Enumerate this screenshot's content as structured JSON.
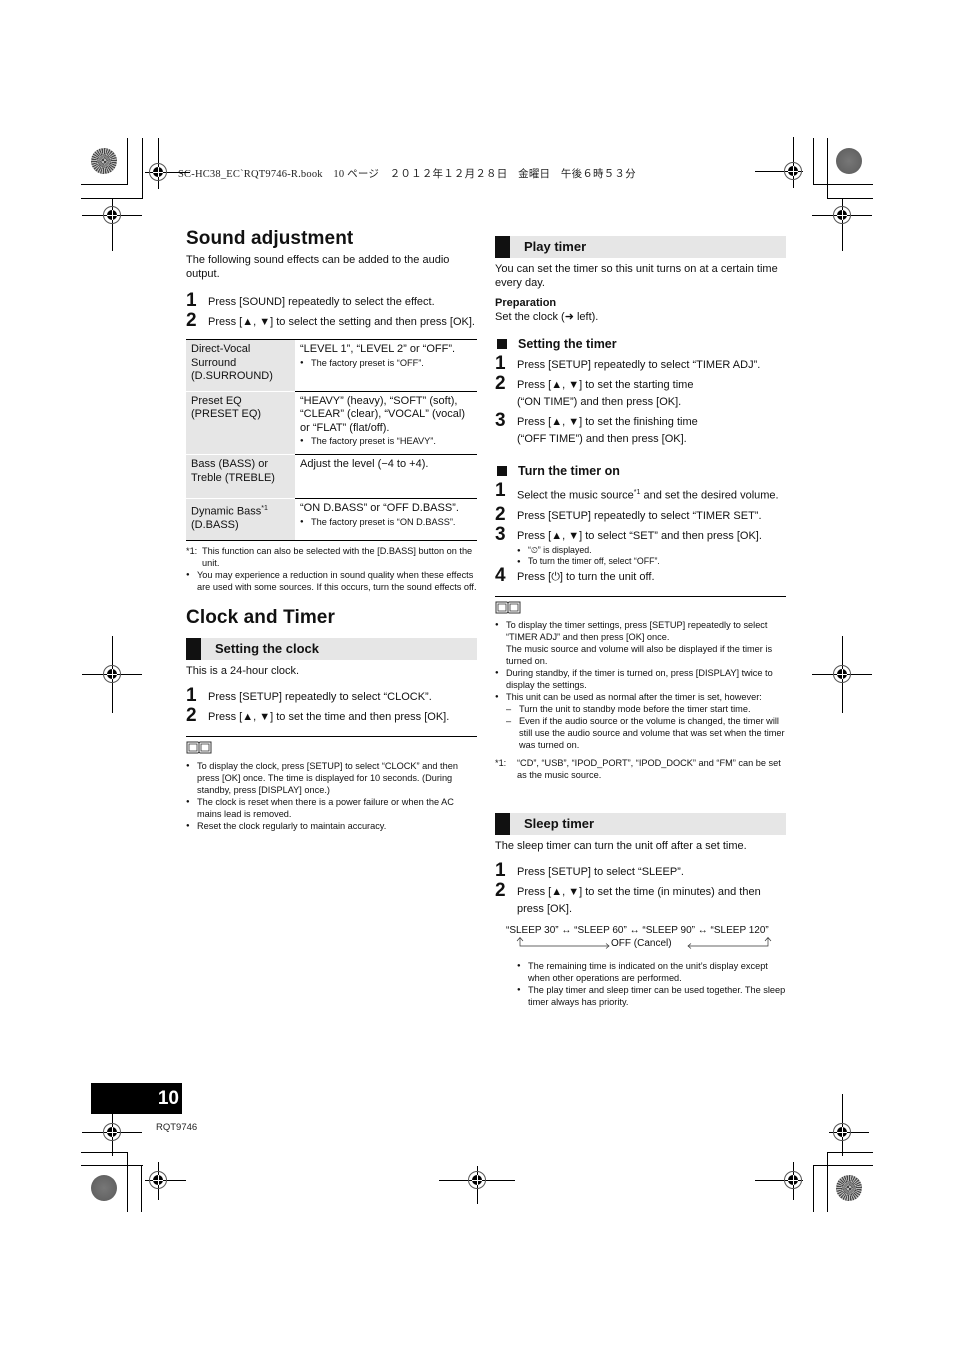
{
  "header": {
    "print_line": "SC-HC38_EC`RQT9746-R.book　10 ページ　２０１２年１２月２８日　金曜日　午後６時５３分"
  },
  "sound_adjustment": {
    "title": "Sound adjustment",
    "intro": "The following sound effects can be added to the audio output.",
    "steps": [
      {
        "num": "1",
        "text": "Press [SOUND] repeatedly to select the effect."
      },
      {
        "num": "2",
        "text": "Press [▲, ▼] to select the setting and then press [OK]."
      }
    ],
    "table": [
      {
        "name": "Direct-Vocal Surround (D.SURROUND)",
        "value": "“LEVEL 1”, “LEVEL 2” or “OFF”.",
        "note": "The factory preset is “OFF”."
      },
      {
        "name": "Preset EQ (PRESET EQ)",
        "value": "“HEAVY” (heavy), “SOFT” (soft), “CLEAR” (clear), “VOCAL” (vocal) or “FLAT” (flat/off).",
        "note": "The factory preset is “HEAVY”."
      },
      {
        "name": "Bass (BASS) or Treble (TREBLE)",
        "value": "Adjust the level (−4 to +4).",
        "note": ""
      },
      {
        "name": "Dynamic Bass",
        "name_sup": "*1",
        "name2": "(D.BASS)",
        "value": "“ON D.BASS” or “OFF D.BASS”.",
        "note": "The factory preset is “ON D.BASS”."
      }
    ],
    "footnote_mark": "*1:",
    "footnote": "This function can also be selected with the [D.BASS] button on the unit.",
    "bullet": "You may experience a reduction in sound quality when these effects are used with some sources. If this occurs, turn the sound effects off."
  },
  "clock_timer": {
    "title": "Clock and Timer",
    "setting_clock": {
      "heading": "Setting the clock",
      "intro": "This is a 24-hour clock.",
      "steps": [
        {
          "num": "1",
          "text": "Press [SETUP] repeatedly to select “CLOCK”."
        },
        {
          "num": "2",
          "text": "Press [▲, ▼] to set the time and then press [OK]."
        }
      ],
      "notes": [
        "To display the clock, press [SETUP] to select “CLOCK” and then press [OK] once. The time is displayed for 10 seconds. (During standby, press [DISPLAY] once.)",
        "The clock is reset when there is a power failure or when the AC mains lead is removed.",
        "Reset the clock regularly to maintain accuracy."
      ]
    }
  },
  "play_timer": {
    "heading": "Play timer",
    "intro": "You can set the timer so this unit turns on at a certain time every day.",
    "prep_label": "Preparation",
    "prep_text": "Set the clock (➜ left).",
    "setting": {
      "heading": "Setting the timer",
      "steps": [
        {
          "num": "1",
          "text": "Press [SETUP] repeatedly to select “TIMER ADJ”."
        },
        {
          "num": "2",
          "text": "Press [▲, ▼] to set the starting time (“ON TIME”) and then press [OK]."
        },
        {
          "num": "3",
          "text": "Press [▲, ▼] to set the finishing time (“OFF TIME”) and then press [OK]."
        }
      ]
    },
    "turn_on": {
      "heading": "Turn the timer on",
      "step1_a": "Select the music source",
      "step1_sup": "*1",
      "step1_b": " and set the desired volume.",
      "step2": "Press [SETUP] repeatedly to select “TIMER SET”.",
      "step3": "Press [▲, ▼] to select “SET” and then press [OK].",
      "step3_notes": [
        "“⏲” is displayed.",
        "To turn the timer off, select “OFF”."
      ],
      "step4": "Press [⏻] to turn the unit off."
    },
    "notes": [
      "To display the timer settings, press [SETUP] repeatedly to select “TIMER ADJ” and then press [OK] once.",
      "The music source and volume will also be displayed if the timer is turned on.",
      "During standby, if the timer is turned on, press [DISPLAY] twice to display the settings.",
      "This unit can be used as normal after the timer is set, however:"
    ],
    "dashes": [
      "Turn the unit to standby mode before the timer start time.",
      "Even if the audio source or the volume is changed, the timer will still use the audio source and volume that was set when the timer was turned on."
    ],
    "footnote_mark": "*1:",
    "footnote": "“CD”, “USB”, “IPOD_PORT”, “IPOD_DOCK” and “FM” can be set as the music source."
  },
  "sleep_timer": {
    "heading": "Sleep timer",
    "intro": "The sleep timer can turn the unit off after a set time.",
    "steps": [
      {
        "num": "1",
        "text": "Press [SETUP] to select “SLEEP”."
      },
      {
        "num": "2",
        "text": "Press [▲, ▼] to set the time (in minutes) and then press [OK]."
      }
    ],
    "sequence": "“SLEEP 30” ↔ “SLEEP 60” ↔ “SLEEP 90” ↔ “SLEEP 120”",
    "cancel": "OFF (Cancel)",
    "notes": [
      "The remaining time is indicated on the unit’s display except when other operations are performed.",
      "The play timer and sleep timer can be used together. The sleep timer always has priority."
    ]
  },
  "footer": {
    "page_number": "10",
    "doc_code": "RQT9746"
  }
}
